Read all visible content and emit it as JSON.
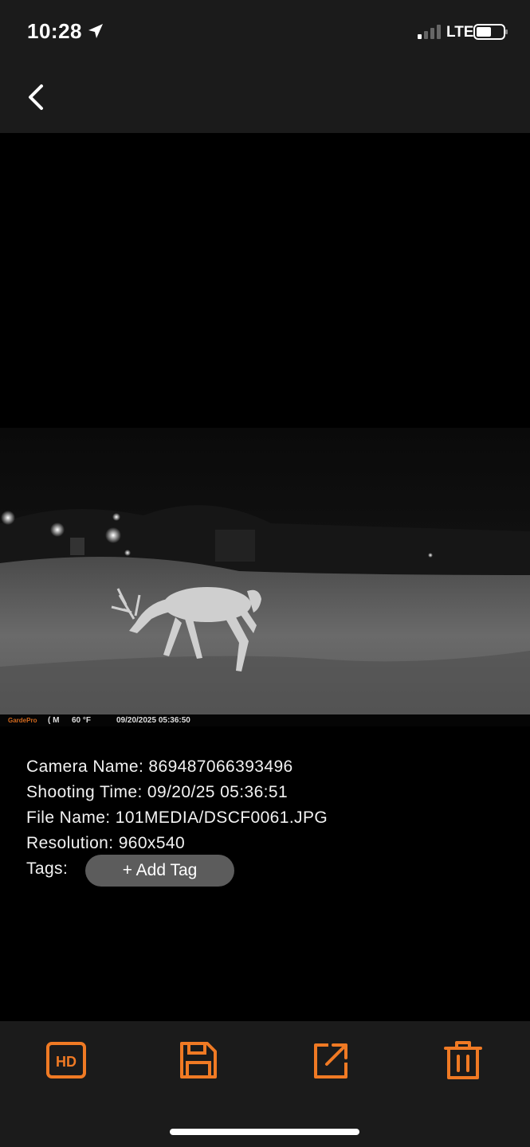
{
  "status_bar": {
    "time": "10:28",
    "network": "LTE",
    "location_icon": "location-arrow-icon",
    "signal_icon": "cellular-signal-icon",
    "battery_icon": "battery-icon"
  },
  "nav": {
    "back_icon": "chevron-left-icon"
  },
  "photo": {
    "brand": "GardePro",
    "moon": "( M",
    "temperature": "60 °F",
    "timestamp": "09/20/2025 05:36:50"
  },
  "details": {
    "camera_name": "Camera Name: 869487066393496",
    "shooting_time": "Shooting Time: 09/20/25 05:36:51",
    "file_name": "File Name: 101MEDIA/DSCF0061.JPG",
    "resolution": "Resolution: 960x540",
    "tags_label": "Tags:",
    "add_tag_label": "+ Add Tag"
  },
  "toolbar": {
    "items": [
      {
        "name": "hd-icon"
      },
      {
        "name": "save-icon"
      },
      {
        "name": "share-icon"
      },
      {
        "name": "trash-icon"
      }
    ],
    "accent": "#f07a24"
  }
}
